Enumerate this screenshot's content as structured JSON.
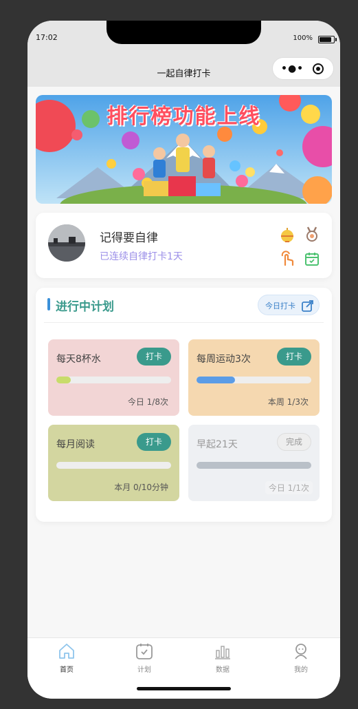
{
  "status_bar": {
    "time": "17:02",
    "battery": "100%"
  },
  "nav": {
    "title": "一起自律打卡"
  },
  "banner": {
    "text": "排行榜功能上线"
  },
  "profile": {
    "name": "记得要自律",
    "streak": "已连续自律打卡1天"
  },
  "plans": {
    "title": "进行中计划",
    "today_button": "今日打卡",
    "cards": [
      {
        "name": "每天8杯水",
        "button": "打卡",
        "stat": "今日 1/8次",
        "progress": 0.125,
        "bg": "#f2d5d5",
        "fill": "#c8dc6a"
      },
      {
        "name": "每周运动3次",
        "button": "打卡",
        "stat": "本周 1/3次",
        "progress": 0.333,
        "bg": "#f5d8b0",
        "fill": "#5b9ce6"
      },
      {
        "name": "每月阅读",
        "button": "打卡",
        "stat": "本月 0/10分钟",
        "progress": 0.0,
        "bg": "#d3d6a0",
        "fill": "#cccccc"
      },
      {
        "name": "早起21天",
        "button": "完成",
        "stat": "今日 1/1次",
        "progress": 1.0,
        "bg": "#eef0f3",
        "fill": "#b9c0c8"
      }
    ]
  },
  "tabbar": {
    "items": [
      {
        "label": "首页",
        "icon": "home-icon",
        "active": true
      },
      {
        "label": "计划",
        "icon": "calendar-icon",
        "active": false
      },
      {
        "label": "数据",
        "icon": "bar-chart-icon",
        "active": false
      },
      {
        "label": "我的",
        "icon": "person-icon",
        "active": false
      }
    ]
  },
  "colors": {
    "accent": "#3a9a8c",
    "streak": "#9b8fe8",
    "title_bar": "#3a90d9"
  }
}
